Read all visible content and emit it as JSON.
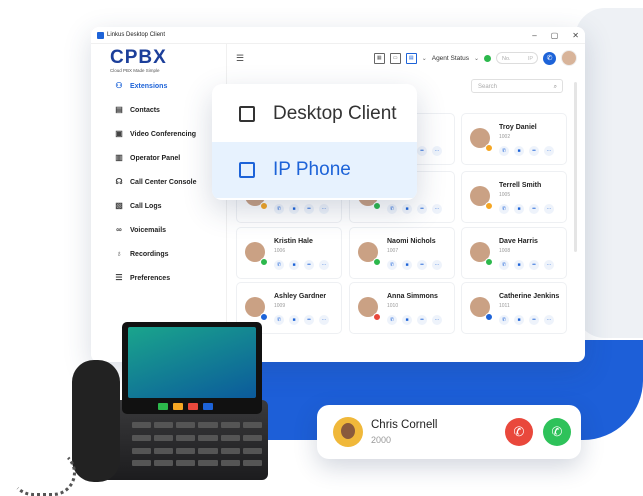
{
  "window": {
    "title": "Linkus Desktop Client",
    "min": "–",
    "max": "▢",
    "close": "✕"
  },
  "logo": {
    "text": "CPBX",
    "tagline": "Cloud PBX Made Simple"
  },
  "nav": [
    {
      "label": "Extensions",
      "icon": "extensions-icon",
      "glyph": "⚇",
      "active": true
    },
    {
      "label": "Contacts",
      "icon": "contacts-icon",
      "glyph": "▤",
      "active": false
    },
    {
      "label": "Video Conferencing",
      "icon": "video-icon",
      "glyph": "▣",
      "active": false
    },
    {
      "label": "Operator Panel",
      "icon": "operator-icon",
      "glyph": "▥",
      "active": false
    },
    {
      "label": "Call Center Console",
      "icon": "headset-icon",
      "glyph": "☊",
      "active": false,
      "chevron": "⌄"
    },
    {
      "label": "Call Logs",
      "icon": "call-logs-icon",
      "glyph": "▧",
      "active": false
    },
    {
      "label": "Voicemails",
      "icon": "voicemail-icon",
      "glyph": "∞",
      "active": false
    },
    {
      "label": "Recordings",
      "icon": "mic-icon",
      "glyph": "♁",
      "active": false
    },
    {
      "label": "Preferences",
      "icon": "preferences-icon",
      "glyph": "☰",
      "active": false
    }
  ],
  "topbar": {
    "agent_status": "Agent Status",
    "no_placeholder": "No.",
    "ip_label": "IP"
  },
  "search": {
    "placeholder": "Search"
  },
  "popup": {
    "options": [
      {
        "label": "Desktop Client",
        "selected": false
      },
      {
        "label": "IP Phone",
        "selected": true
      }
    ]
  },
  "cards": [
    {
      "name": "...ings",
      "ext": "",
      "status": "#1d63d8"
    },
    {
      "name": "Troy Daniel",
      "ext": "1002",
      "status": "#f5a623"
    },
    {
      "name": "",
      "ext": "",
      "status": "#f5a623"
    },
    {
      "name": "...d",
      "ext": "",
      "status": "#2cb84c"
    },
    {
      "name": "Terrell Smith",
      "ext": "1005",
      "status": "#f5a623"
    },
    {
      "name": "Kristin Hale",
      "ext": "1006",
      "status": "#2cb84c"
    },
    {
      "name": "Naomi Nichols",
      "ext": "1007",
      "status": "#2cb84c"
    },
    {
      "name": "Dave Harris",
      "ext": "1008",
      "status": "#2cb84c"
    },
    {
      "name": "Ashley Gardner",
      "ext": "1009",
      "status": "#1d63d8"
    },
    {
      "name": "Anna Simmons",
      "ext": "1010",
      "status": "#e9483c"
    },
    {
      "name": "Catherine Jenkins",
      "ext": "1011",
      "status": "#1d63d8"
    }
  ],
  "call": {
    "name": "Chris Cornell",
    "number": "2000"
  },
  "colors": {
    "accent": "#1d63d8",
    "brand_dark": "#1c3f9a",
    "decline": "#e9483c",
    "accept": "#2ec25a"
  }
}
